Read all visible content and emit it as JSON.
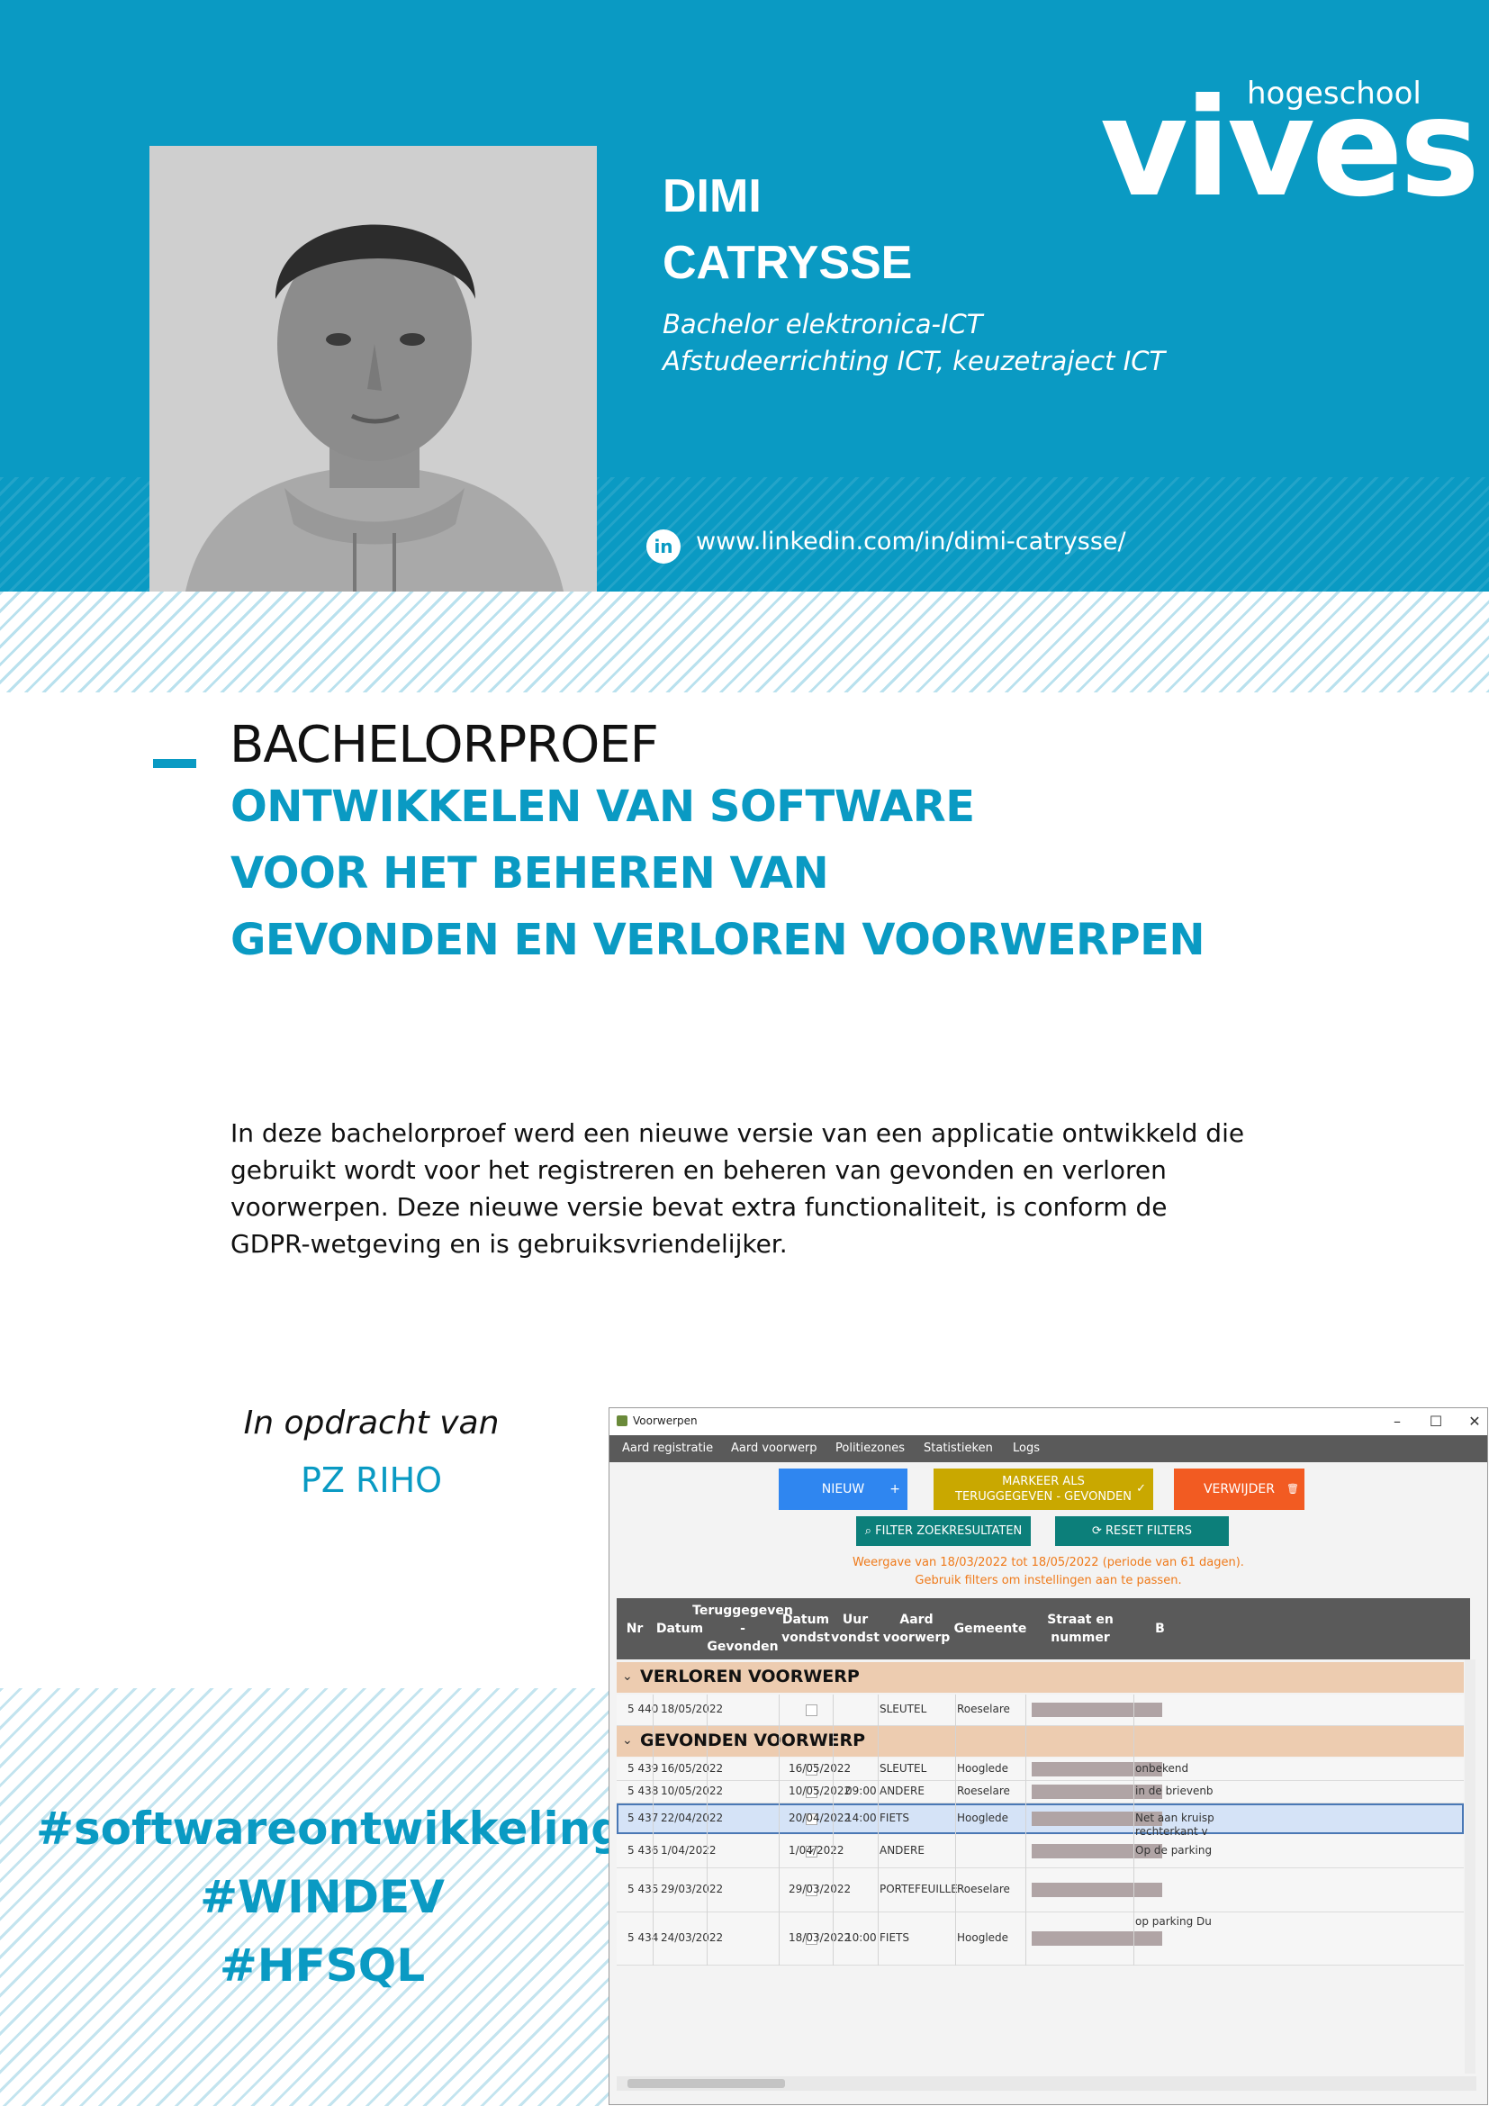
{
  "header": {
    "logo_small": "hogeschool",
    "logo_big": "vives",
    "first_name": "DIMI",
    "last_name": "CATRYSSE",
    "study_line1": "Bachelor elektronica-ICT",
    "study_line2": "Afstudeerrichting ICT, keuzetraject ICT",
    "linkedin_icon": "in",
    "linkedin_url": "www.linkedin.com/in/dimi-catrysse/",
    "colors": {
      "brand": "#0a9ac3"
    }
  },
  "thesis": {
    "label": "BACHELORPROEF",
    "title_lines": [
      "ONTWIKKELEN VAN SOFTWARE",
      "VOOR HET BEHEREN VAN",
      "GEVONDEN EN VERLOREN VOORWERPEN"
    ],
    "abstract": "In deze bachelorproef werd een nieuwe versie van een applicatie ontwikkeld die gebruikt wordt voor het registreren en beheren van gevonden en verloren voorwerpen. Deze nieuwe versie bevat extra functionaliteit, is conform de GDPR-wetgeving en is gebruiksvriendelijker."
  },
  "client": {
    "label": "In opdracht van",
    "name": "PZ RIHO"
  },
  "hashtags": [
    "#softwareontwikkeling",
    "#WINDEV",
    "#HFSQL"
  ],
  "app": {
    "window_title": "Voorwerpen",
    "window_controls": {
      "minimize": "–",
      "maximize": "☐",
      "close": "✕"
    },
    "menu": [
      "Aard registratie",
      "Aard voorwerp",
      "Politiezones",
      "Statistieken",
      "Logs"
    ],
    "buttons": {
      "new": "NIEUW",
      "new_icon": "+",
      "mark_line1": "MARKEER ALS",
      "mark_line2": "TERUGGEGEVEN - GEVONDEN",
      "mark_icon": "✓",
      "delete": "VERWIJDER",
      "delete_icon": "🗑",
      "filter": "⌕ FILTER ZOEKRESULTATEN",
      "reset": "⟳ RESET FILTERS"
    },
    "notice_line1": "Weergave van 18/03/2022 tot 18/05/2022 (periode van 61 dagen).",
    "notice_line2": "Gebruik filters om instellingen aan te passen.",
    "columns": [
      "Nr",
      "Datum",
      "Teruggegeven\n-\nGevonden",
      "Datum\nvondst",
      "Uur\nvondst",
      "Aard\nvoorwerp",
      "Gemeente",
      "Straat en nummer",
      "B"
    ],
    "groups": [
      {
        "label": "VERLOREN VOORWERP",
        "rows": [
          {
            "nr": "5 440",
            "datum": "18/05/2022",
            "checked": "",
            "vondst": "",
            "uur": "",
            "aard": "SLEUTEL",
            "gemeente": "Roeselare",
            "b": ""
          }
        ]
      },
      {
        "label": "GEVONDEN VOORWERP",
        "rows": [
          {
            "nr": "5 439",
            "datum": "16/05/2022",
            "checked": "",
            "vondst": "16/05/2022",
            "uur": "",
            "aard": "SLEUTEL",
            "gemeente": "Hooglede",
            "b": "onbekend"
          },
          {
            "nr": "5 438",
            "datum": "10/05/2022",
            "checked": "",
            "vondst": "10/05/2022",
            "uur": "09:00",
            "aard": "ANDERE",
            "gemeente": "Roeselare",
            "b": "in de brievenb"
          },
          {
            "nr": "5 437",
            "datum": "22/04/2022",
            "checked": "",
            "vondst": "20/04/2022",
            "uur": "14:00",
            "aard": "FIETS",
            "gemeente": "Hooglede",
            "b": "Net aan kruisp rechterkant v omheining"
          },
          {
            "nr": "5 436",
            "datum": "1/04/2022",
            "checked": "✓",
            "vondst": "1/04/2022",
            "uur": "",
            "aard": "ANDERE",
            "gemeente": "",
            "b": "Op de parking"
          },
          {
            "nr": "5 435",
            "datum": "29/03/2022",
            "checked": "",
            "vondst": "29/03/2022",
            "uur": "",
            "aard": "PORTEFEUILLE",
            "gemeente": "Roeselare",
            "b": ""
          },
          {
            "nr": "5 434",
            "datum": "24/03/2022",
            "checked": "",
            "vondst": "18/03/2022",
            "uur": "10:00",
            "aard": "FIETS",
            "gemeente": "Hooglede",
            "b": "op parking Du"
          }
        ]
      }
    ]
  }
}
